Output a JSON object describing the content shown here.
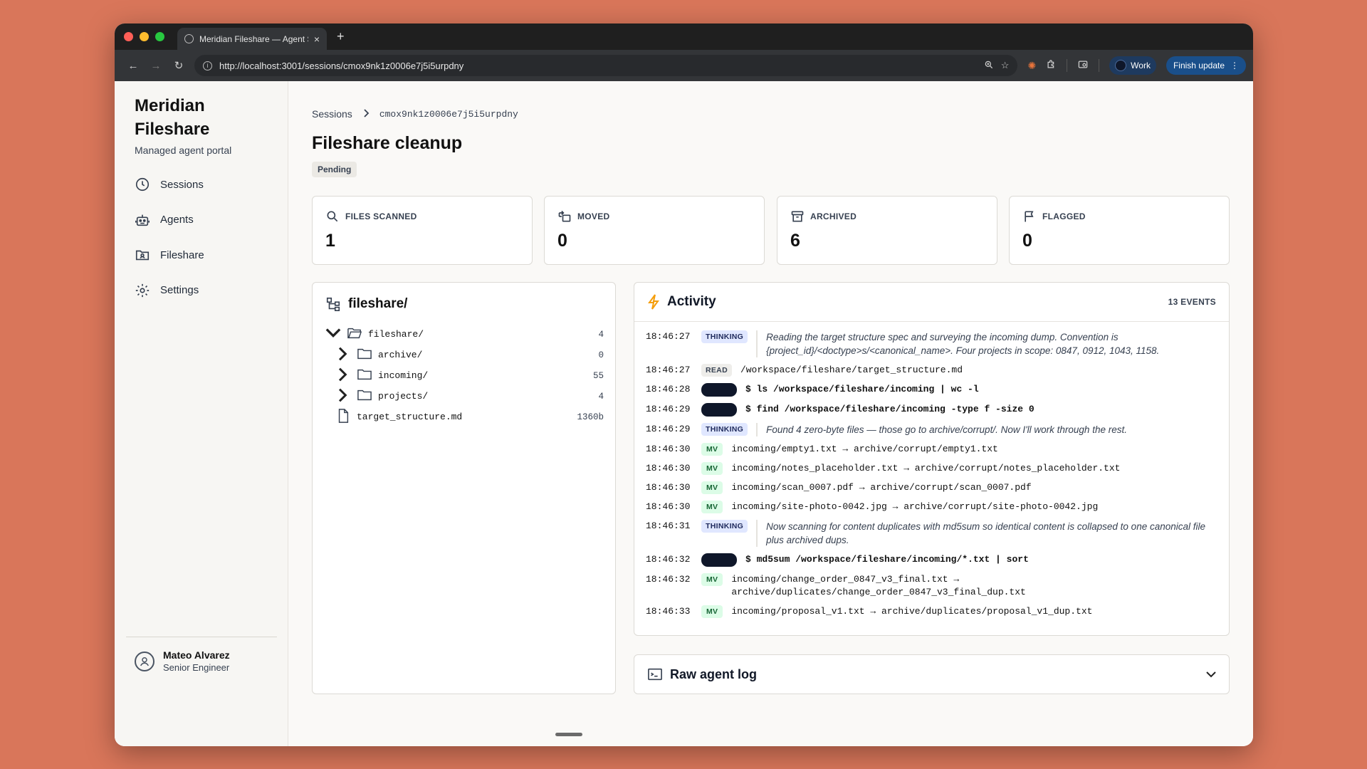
{
  "browser": {
    "tab_title": "Meridian Fileshare — Agent S",
    "url": "http://localhost:3001/sessions/cmox9nk1z0006e7j5i5urpdny",
    "profile_label": "Work",
    "update_label": "Finish update"
  },
  "sidebar": {
    "brand": "Meridian Fileshare",
    "subtitle": "Managed agent portal",
    "items": [
      {
        "label": "Sessions",
        "icon": "clock-icon"
      },
      {
        "label": "Agents",
        "icon": "robot-icon"
      },
      {
        "label": "Fileshare",
        "icon": "folder-user-icon"
      },
      {
        "label": "Settings",
        "icon": "gear-icon"
      }
    ],
    "user": {
      "name": "Mateo Alvarez",
      "role": "Senior Engineer"
    }
  },
  "main": {
    "breadcrumb": {
      "root": "Sessions",
      "current": "cmox9nk1z0006e7j5i5urpdny"
    },
    "title": "Fileshare cleanup",
    "status": "Pending",
    "stats": [
      {
        "label": "FILES SCANNED",
        "value": "1",
        "icon": "search-icon"
      },
      {
        "label": "MOVED",
        "value": "0",
        "icon": "move-icon"
      },
      {
        "label": "ARCHIVED",
        "value": "6",
        "icon": "archive-icon"
      },
      {
        "label": "FLAGGED",
        "value": "0",
        "icon": "flag-icon"
      }
    ]
  },
  "tree": {
    "title": "fileshare/",
    "rows": [
      {
        "name": "fileshare/",
        "count": "4",
        "type": "folder-open",
        "expanded": true
      },
      {
        "name": "archive/",
        "count": "0",
        "type": "folder"
      },
      {
        "name": "incoming/",
        "count": "55",
        "type": "folder"
      },
      {
        "name": "projects/",
        "count": "4",
        "type": "folder"
      },
      {
        "name": "target_structure.md",
        "count": "1360b",
        "type": "file"
      }
    ]
  },
  "activity": {
    "title": "Activity",
    "count": "13 EVENTS",
    "events": [
      {
        "time": "18:46:27",
        "tag": "THINKING",
        "kind": "thinking",
        "text": "Reading the target structure spec and surveying the incoming dump. Convention is {project_id}/<doctype>s/<canonical_name>. Four projects in scope: 0847, 0912, 1043, 1158."
      },
      {
        "time": "18:46:27",
        "tag": "READ",
        "kind": "read",
        "text": "/workspace/fileshare/target_structure.md"
      },
      {
        "time": "18:46:28",
        "tag": "",
        "kind": "cmd",
        "text": "$ ls /workspace/fileshare/incoming | wc -l"
      },
      {
        "time": "18:46:29",
        "tag": "",
        "kind": "cmd",
        "text": "$ find /workspace/fileshare/incoming -type f -size 0"
      },
      {
        "time": "18:46:29",
        "tag": "THINKING",
        "kind": "thinking",
        "text": "Found 4 zero-byte files — those go to archive/corrupt/. Now I'll work through the rest."
      },
      {
        "time": "18:46:30",
        "tag": "MV",
        "kind": "mv",
        "text": "incoming/empty1.txt → archive/corrupt/empty1.txt"
      },
      {
        "time": "18:46:30",
        "tag": "MV",
        "kind": "mv",
        "text": "incoming/notes_placeholder.txt → archive/corrupt/notes_placeholder.txt"
      },
      {
        "time": "18:46:30",
        "tag": "MV",
        "kind": "mv",
        "text": "incoming/scan_0007.pdf → archive/corrupt/scan_0007.pdf"
      },
      {
        "time": "18:46:30",
        "tag": "MV",
        "kind": "mv",
        "text": "incoming/site-photo-0042.jpg → archive/corrupt/site-photo-0042.jpg"
      },
      {
        "time": "18:46:31",
        "tag": "THINKING",
        "kind": "thinking",
        "text": "Now scanning for content duplicates with md5sum so identical content is collapsed to one canonical file plus archived dups."
      },
      {
        "time": "18:46:32",
        "tag": "",
        "kind": "cmd",
        "text": "$ md5sum /workspace/fileshare/incoming/*.txt | sort"
      },
      {
        "time": "18:46:32",
        "tag": "MV",
        "kind": "mv",
        "text": "incoming/change_order_0847_v3_final.txt → archive/duplicates/change_order_0847_v3_final_dup.txt"
      },
      {
        "time": "18:46:33",
        "tag": "MV",
        "kind": "mv",
        "text": "incoming/proposal_v1.txt → archive/duplicates/proposal_v1_dup.txt"
      }
    ]
  },
  "rawlog": {
    "title": "Raw agent log"
  }
}
